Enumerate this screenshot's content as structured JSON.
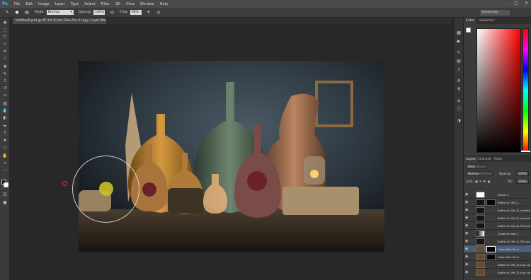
{
  "app": {
    "logo": "Ps"
  },
  "menu": [
    "File",
    "Edit",
    "Image",
    "Layer",
    "Type",
    "Select",
    "Filter",
    "3D",
    "View",
    "Window",
    "Help"
  ],
  "window_controls": [
    "–",
    "□",
    "✕"
  ],
  "options_bar": {
    "mode_label": "Mode:",
    "mode_value": "Normal",
    "opacity_label": "Opacity:",
    "opacity_value": "100%",
    "flow_label": "Flow:",
    "flow_value": "98%",
    "workspace": "Essentials"
  },
  "document_tab": "Untitled2.psd @ 45.1% (Color Efex Pro 4 copy, Layer Mask/8) *",
  "color_panel": {
    "tabs": [
      "Color",
      "Swatches"
    ]
  },
  "layers_panel": {
    "tabs": [
      "Layers",
      "Channels",
      "Paths"
    ],
    "kind_label": "Kind",
    "blend_mode": "Normal",
    "opacity_label": "Opacity:",
    "opacity_value": "100%",
    "lock_label": "Lock:",
    "fill_label": "Fill:",
    "fill_value": "100%",
    "layers": [
      {
        "name": "Levels 1",
        "selected": false
      },
      {
        "name": "Bottle of Life_2...",
        "selected": false
      },
      {
        "name": "Bottle of Life_2L.shadow.png",
        "selected": false
      },
      {
        "name": "Bottle of Life_2L.specular.png",
        "selected": false
      },
      {
        "name": "Bottle of Life_2L.ESS.png",
        "selected": false
      },
      {
        "name": "Gradient Map 1",
        "selected": false
      },
      {
        "name": "Bottle of Life_2L.DE.png",
        "selected": false
      },
      {
        "name": "Color Efex Pro 4 ...",
        "selected": true
      },
      {
        "name": "Color Efex Pro 4",
        "selected": false
      },
      {
        "name": "Bottle of Life_21.png copy 2",
        "selected": false
      },
      {
        "name": "Bottle of Life_21.png copy",
        "selected": false
      }
    ]
  },
  "colors": {
    "accent": "#38b6ff",
    "selection": "#4a5e78"
  }
}
